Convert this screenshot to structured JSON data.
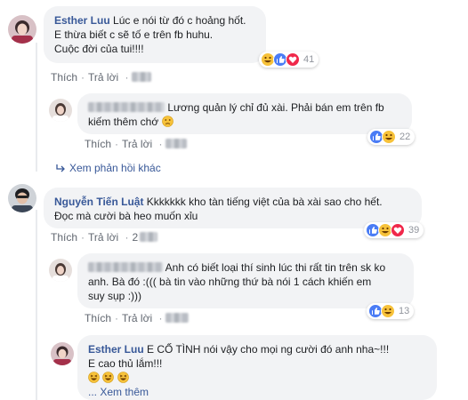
{
  "colors": {
    "link": "#385898",
    "bubble": "#f2f3f5",
    "muted": "#616770",
    "like": "#4a7cf5",
    "haha": "#f7c23a",
    "love": "#f0284a"
  },
  "actions": {
    "like": "Thích",
    "reply": "Trả lời",
    "separator": "·"
  },
  "comments": [
    {
      "author": "Esther Luu",
      "lines": [
        "Lúc e nói từ đó c hoảng hốt.",
        "E thừa biết c sẽ tố e trên fb huhu.",
        "Cuộc đời của tui!!!!"
      ],
      "reaction_count": "41",
      "reactions": [
        "haha-icon",
        "like-icon",
        "love-icon"
      ]
    },
    {
      "lines": [
        "Lương quản lý chỉ đủ xài. Phải bán em trên fb",
        "kiếm thêm chớ"
      ],
      "emoji": "confused-face",
      "reaction_count": "22",
      "reactions": [
        "like-icon",
        "haha-icon"
      ]
    },
    {
      "more_replies": "Xem phản hồi khác"
    },
    {
      "author": "Nguyễn Tiến Luật",
      "lines": [
        "Kkkkkkk kho tàn tiếng việt của bà xài sao cho hết.",
        "Đọc mà cười bà heo muốn xỉu"
      ],
      "time": "2",
      "reaction_count": "39",
      "reactions": [
        "like-icon",
        "haha-icon",
        "love-icon"
      ]
    },
    {
      "lines": [
        "Anh có biết loại thí sinh lúc thi rất tin trên sk ko",
        "anh. Bà đó :((( bà tin vào những thứ bà nói 1 cách khiến em",
        "suy sụp :)))"
      ],
      "reaction_count": "13",
      "reactions": [
        "like-icon",
        "haha-icon"
      ]
    },
    {
      "author": "Esther Luu",
      "lines": [
        "E CỐ TÌNH nói vậy cho mọi ng cười đó anh nha~!!!",
        "E cao thủ lắm!!!"
      ],
      "emoji_row": [
        "grinning-squint",
        "grinning-squint",
        "grinning-squint"
      ],
      "see_more": "... Xem thêm"
    }
  ]
}
